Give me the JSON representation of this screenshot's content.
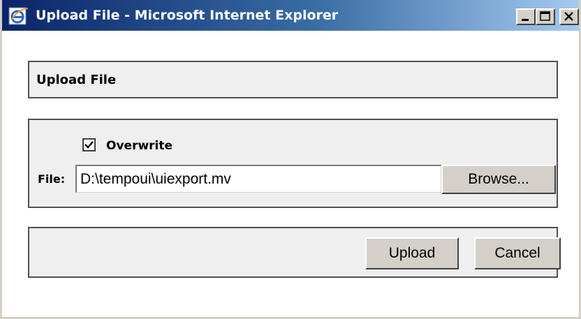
{
  "window": {
    "title": "Upload File - Microsoft Internet Explorer",
    "icon": "ie-icon",
    "controls": [
      "minimize-icon",
      "maximize-icon",
      "close-icon"
    ]
  },
  "header": {
    "title": "Upload File"
  },
  "form": {
    "overwrite": {
      "label": "Overwrite",
      "checked": true
    },
    "file": {
      "label": "File:",
      "value": "D:\\tempoui\\uiexport.mv",
      "browse_label": "Browse..."
    }
  },
  "actions": {
    "upload_label": "Upload",
    "cancel_label": "Cancel"
  },
  "colors": {
    "titlebar_start": "#0a246a",
    "titlebar_end": "#a6caf0",
    "panel_bg": "#efefef",
    "button_face": "#d4d0c8"
  }
}
